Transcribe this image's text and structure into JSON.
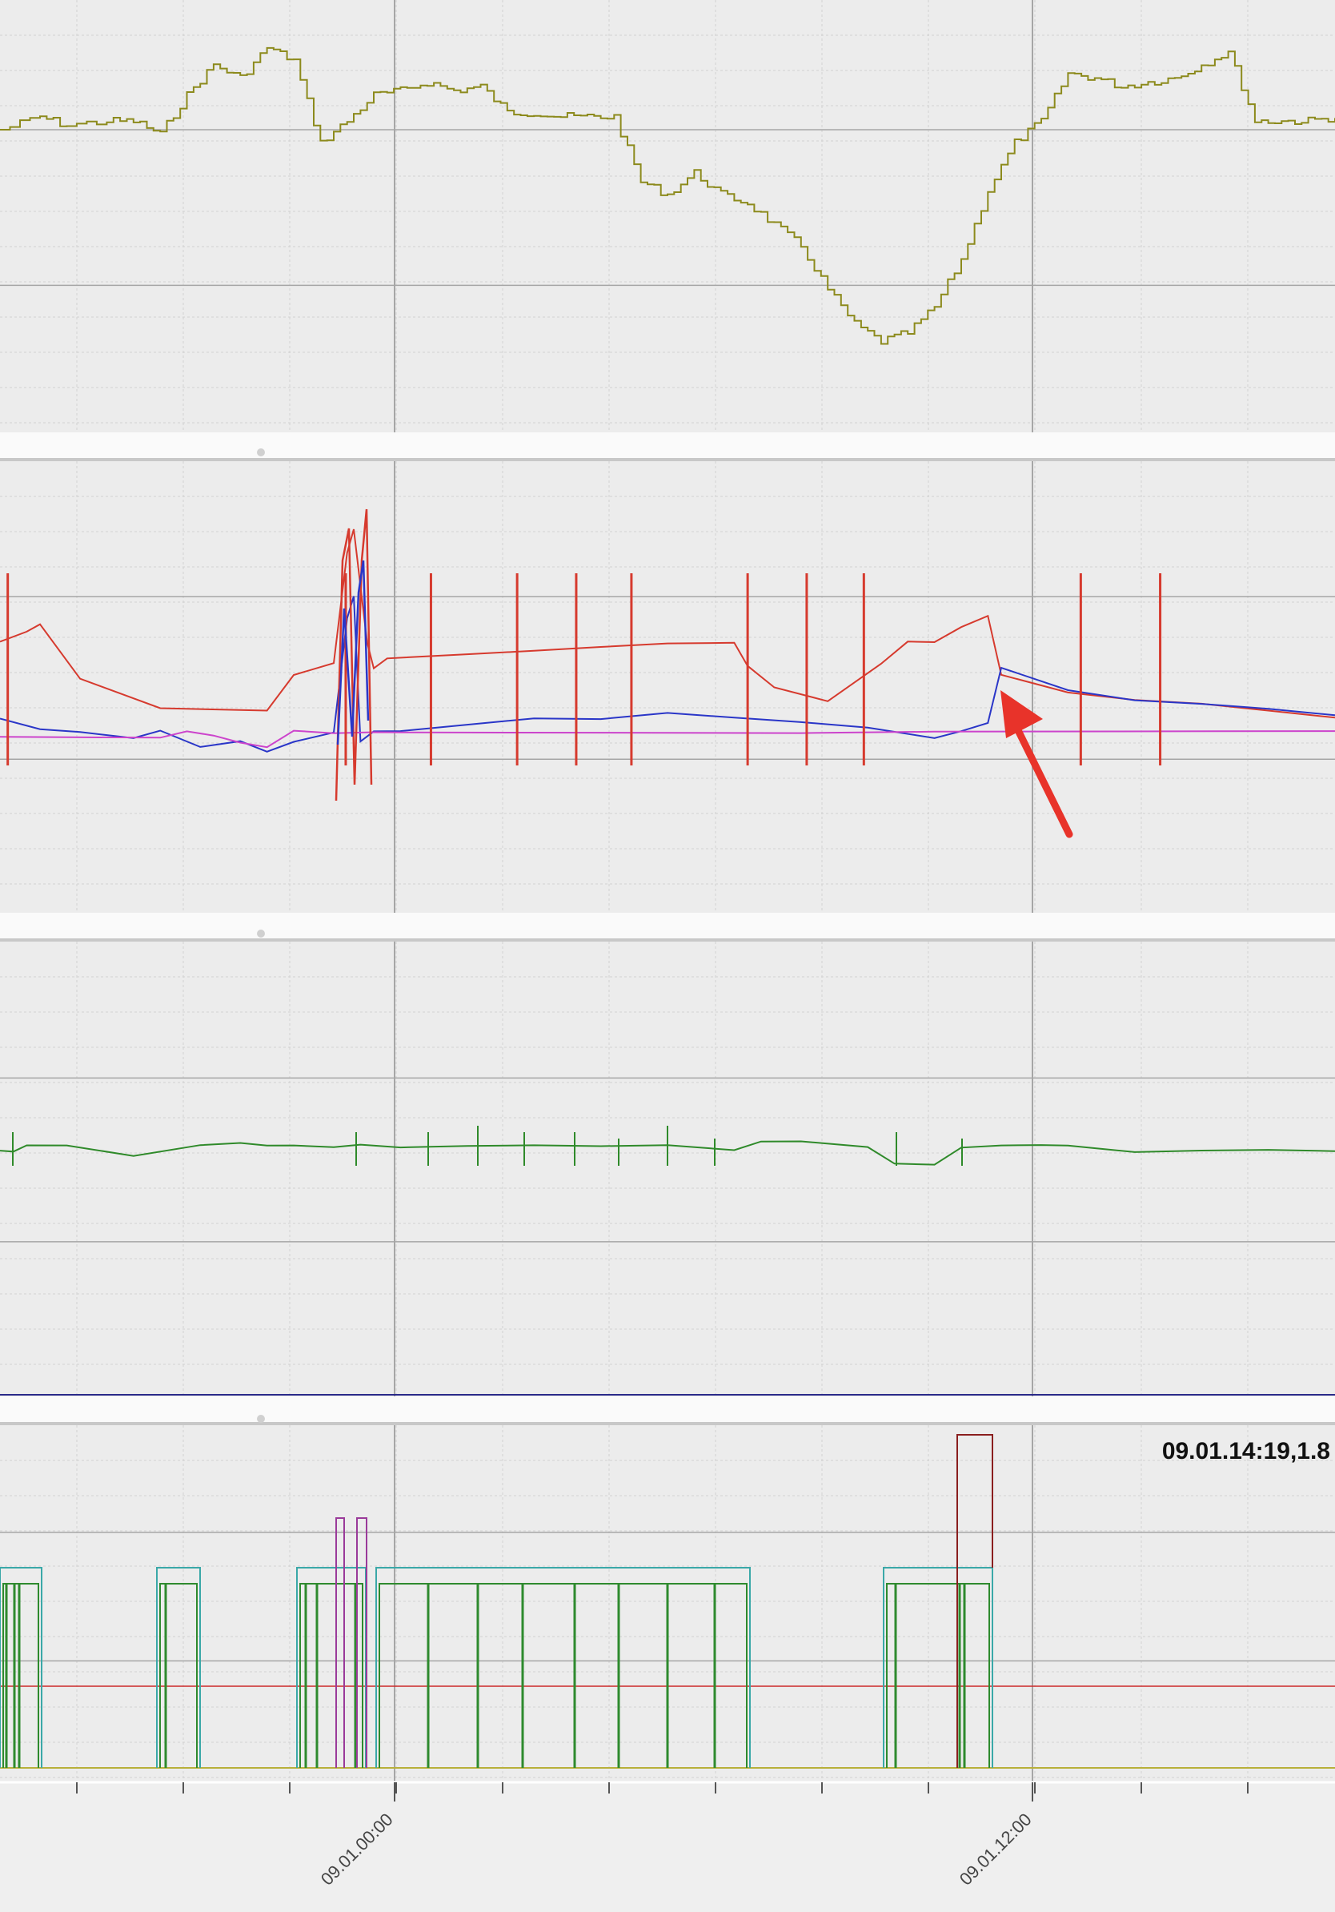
{
  "window": {
    "background": "#efefef",
    "grid_major_color": "#a6a6a6",
    "grid_minor_color": "#d2d2d2"
  },
  "cursor_readout": "09.01.14:19,1.8",
  "x_axis": {
    "tick_labels": [
      {
        "label": "09.01.00:00"
      },
      {
        "label": "09.01.12:00"
      }
    ]
  },
  "annotation": {
    "type": "arrow",
    "color": "#e8332a"
  },
  "chart_data": [
    {
      "panel": "top",
      "type": "line",
      "grid": true,
      "series": [
        {
          "color": "#8c8a1c",
          "step": true,
          "x": [
            0,
            3,
            5,
            8,
            10,
            12,
            14,
            16,
            18,
            20,
            22,
            24,
            26,
            28,
            30,
            32,
            34,
            36,
            38,
            40,
            42,
            44,
            46,
            48,
            50,
            52,
            54,
            56,
            58,
            60,
            62,
            64,
            66,
            68,
            70,
            72,
            74,
            76,
            78,
            80,
            82,
            84,
            86,
            88,
            90,
            92,
            94,
            96,
            98,
            100
          ],
          "y": [
            0.3,
            0.27,
            0.29,
            0.28,
            0.28,
            0.31,
            0.22,
            0.15,
            0.18,
            0.11,
            0.14,
            0.33,
            0.28,
            0.22,
            0.21,
            0.19,
            0.21,
            0.2,
            0.26,
            0.26,
            0.27,
            0.27,
            0.27,
            0.42,
            0.45,
            0.4,
            0.45,
            0.47,
            0.52,
            0.57,
            0.67,
            0.75,
            0.79,
            0.77,
            0.71,
            0.6,
            0.44,
            0.33,
            0.28,
            0.17,
            0.18,
            0.2,
            0.19,
            0.18,
            0.15,
            0.12,
            0.28,
            0.28,
            0.28,
            0.27
          ]
        }
      ]
    },
    {
      "panel": "second",
      "type": "line",
      "grid": true,
      "series": [
        {
          "color": "#d63a2e",
          "x": [
            0,
            2,
            3,
            6,
            12,
            20,
            22,
            25,
            26,
            26.5,
            27.5,
            28,
            29,
            35,
            40,
            45,
            50,
            55,
            56,
            58,
            62,
            66,
            68,
            70,
            72,
            74,
            75,
            80,
            85,
            90,
            95,
            100
          ],
          "y": [
            0.4,
            0.38,
            0.36,
            0.48,
            0.55,
            0.55,
            0.47,
            0.45,
            0.2,
            0.15,
            0.4,
            0.46,
            0.44,
            0.43,
            0.42,
            0.41,
            0.4,
            0.4,
            0.45,
            0.5,
            0.53,
            0.45,
            0.4,
            0.4,
            0.37,
            0.34,
            0.47,
            0.51,
            0.53,
            0.54,
            0.55,
            0.57
          ]
        },
        {
          "color": "#2a36c8",
          "x": [
            0,
            3,
            6,
            10,
            12,
            15,
            18,
            20,
            22,
            25,
            26,
            26.5,
            27,
            28,
            30,
            35,
            40,
            45,
            50,
            55,
            60,
            65,
            70,
            72,
            74,
            75,
            80,
            85,
            90,
            95,
            100
          ],
          "y": [
            0.57,
            0.59,
            0.6,
            0.61,
            0.6,
            0.63,
            0.62,
            0.64,
            0.62,
            0.6,
            0.35,
            0.3,
            0.62,
            0.6,
            0.6,
            0.58,
            0.57,
            0.57,
            0.56,
            0.57,
            0.58,
            0.59,
            0.61,
            0.6,
            0.58,
            0.46,
            0.51,
            0.53,
            0.54,
            0.55,
            0.56
          ]
        },
        {
          "color": "#cc44cc",
          "x": [
            0,
            12,
            14,
            16,
            18,
            20,
            22,
            25,
            28,
            30,
            60,
            70,
            100
          ],
          "y": [
            0.61,
            0.61,
            0.6,
            0.61,
            0.62,
            0.63,
            0.6,
            0.6,
            0.6,
            0.6,
            0.6,
            0.6,
            0.6
          ]
        }
      ]
    },
    {
      "panel": "third",
      "type": "line",
      "grid": true,
      "series": [
        {
          "color": "#2f8a2a",
          "x": [
            0,
            1,
            2,
            5,
            10,
            15,
            18,
            20,
            22,
            25,
            27,
            30,
            35,
            40,
            45,
            50,
            55,
            57,
            60,
            65,
            67,
            70,
            72,
            75,
            78,
            80,
            85,
            90,
            95,
            100
          ],
          "y": [
            0.46,
            0.46,
            0.45,
            0.45,
            0.47,
            0.45,
            0.44,
            0.45,
            0.45,
            0.45,
            0.45,
            0.45,
            0.45,
            0.45,
            0.45,
            0.45,
            0.46,
            0.44,
            0.44,
            0.45,
            0.49,
            0.49,
            0.45,
            0.45,
            0.45,
            0.45,
            0.46,
            0.46,
            0.46,
            0.46
          ]
        }
      ]
    },
    {
      "panel": "bottom",
      "type": "line",
      "grid": true,
      "series": [
        {
          "color": "#3aa8a8",
          "step": true
        },
        {
          "color": "#2e8a2e",
          "step": true
        },
        {
          "color": "#9a3a9a",
          "step": true
        },
        {
          "color": "#8a1e1e",
          "step": true
        },
        {
          "color": "#cc2a2a"
        },
        {
          "color": "#b8b03a"
        }
      ]
    }
  ]
}
